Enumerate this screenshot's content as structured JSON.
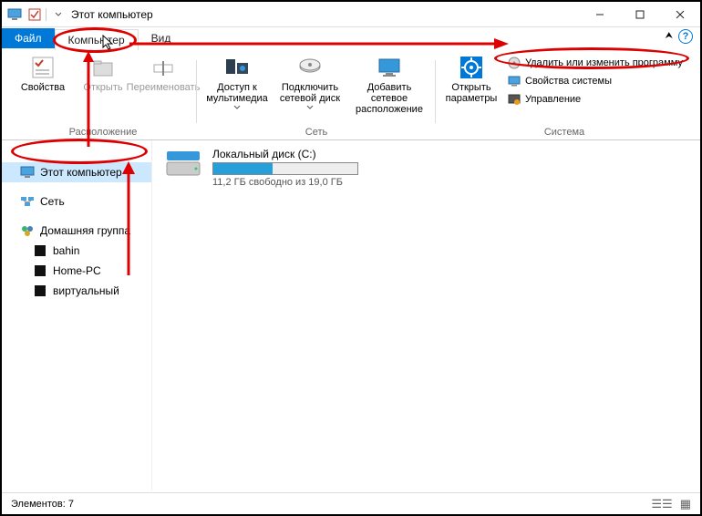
{
  "titlebar": {
    "title": "Этот компьютер"
  },
  "tabs": {
    "file": "Файл",
    "computer": "Компьютер",
    "view": "Вид"
  },
  "ribbon": {
    "group_location": "Расположение",
    "group_network": "Сеть",
    "group_system": "Система",
    "properties": "Свойства",
    "open": "Открыть",
    "rename": "Переименовать",
    "media_access": "Доступ к мультимедиа",
    "map_drive": "Подключить сетевой диск",
    "add_net_location": "Добавить сетевое расположение",
    "open_settings": "Открыть параметры",
    "uninstall_change": "Удалить или изменить программу",
    "system_props": "Свойства системы",
    "manage": "Управление"
  },
  "sidebar": {
    "this_pc": "Этот компьютер",
    "network": "Сеть",
    "homegroup": "Домашняя группа",
    "items": [
      {
        "label": "bahin"
      },
      {
        "label": "Home-PC"
      },
      {
        "label": "виртуальный"
      }
    ]
  },
  "main": {
    "drive_name": "Локальный диск (C:)",
    "drive_free": "11,2 ГБ свободно из 19,0 ГБ"
  },
  "statusbar": {
    "items": "Элементов: 7"
  }
}
